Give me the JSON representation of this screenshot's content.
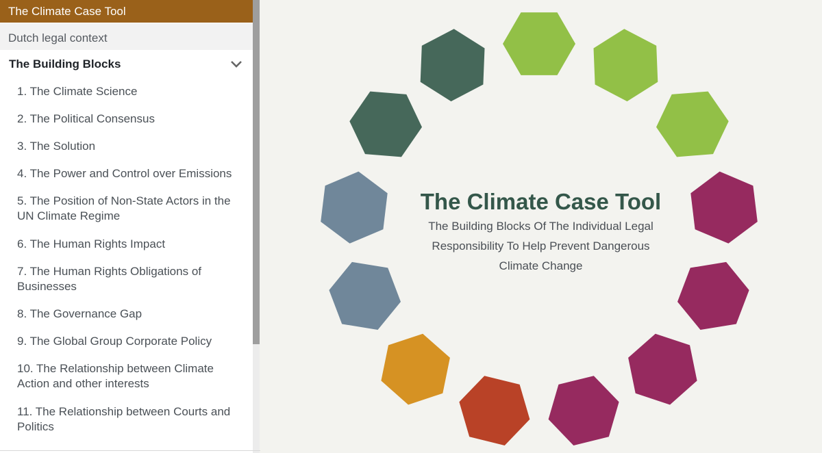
{
  "sidebar": {
    "title": "The Climate Case Tool",
    "context_link": "Dutch legal context",
    "section": {
      "label": "The Building Blocks",
      "expanded": true,
      "toggle_icon": "chevron-down-icon"
    },
    "items": [
      {
        "label": "1. The Climate Science"
      },
      {
        "label": "2. The Political Consensus"
      },
      {
        "label": "3. The Solution"
      },
      {
        "label": "4. The Power and Control over Emissions"
      },
      {
        "label": "5. The Position of Non-State Actors in the UN Climate Regime"
      },
      {
        "label": "6. The Human Rights Impact"
      },
      {
        "label": "7. The Human Rights Obligations of Businesses"
      },
      {
        "label": "8. The Governance Gap"
      },
      {
        "label": "9. The Global Group Corporate Policy"
      },
      {
        "label": "10. The Relationship between Climate Action and other interests"
      },
      {
        "label": "11. The Relationship between Courts and Politics"
      }
    ]
  },
  "main": {
    "title": "The Climate Case Tool",
    "subtitle": "The Building Blocks Of The Individual Legal Responsibility To Help Prevent Dangerous Climate Change"
  },
  "colors": {
    "header_brown": "#9a611a",
    "title_green": "#34574a",
    "light_green": "#92c047",
    "dark_green": "#46685a",
    "purple": "#962a5f",
    "red": "#b94227",
    "orange": "#d69223",
    "slate_blue": "#70879a"
  },
  "hex_ring": [
    {
      "color": "light_green"
    },
    {
      "color": "light_green"
    },
    {
      "color": "light_green"
    },
    {
      "color": "purple"
    },
    {
      "color": "purple"
    },
    {
      "color": "purple"
    },
    {
      "color": "purple"
    },
    {
      "color": "red"
    },
    {
      "color": "orange"
    },
    {
      "color": "slate_blue"
    },
    {
      "color": "slate_blue"
    },
    {
      "color": "dark_green"
    },
    {
      "color": "dark_green"
    }
  ]
}
